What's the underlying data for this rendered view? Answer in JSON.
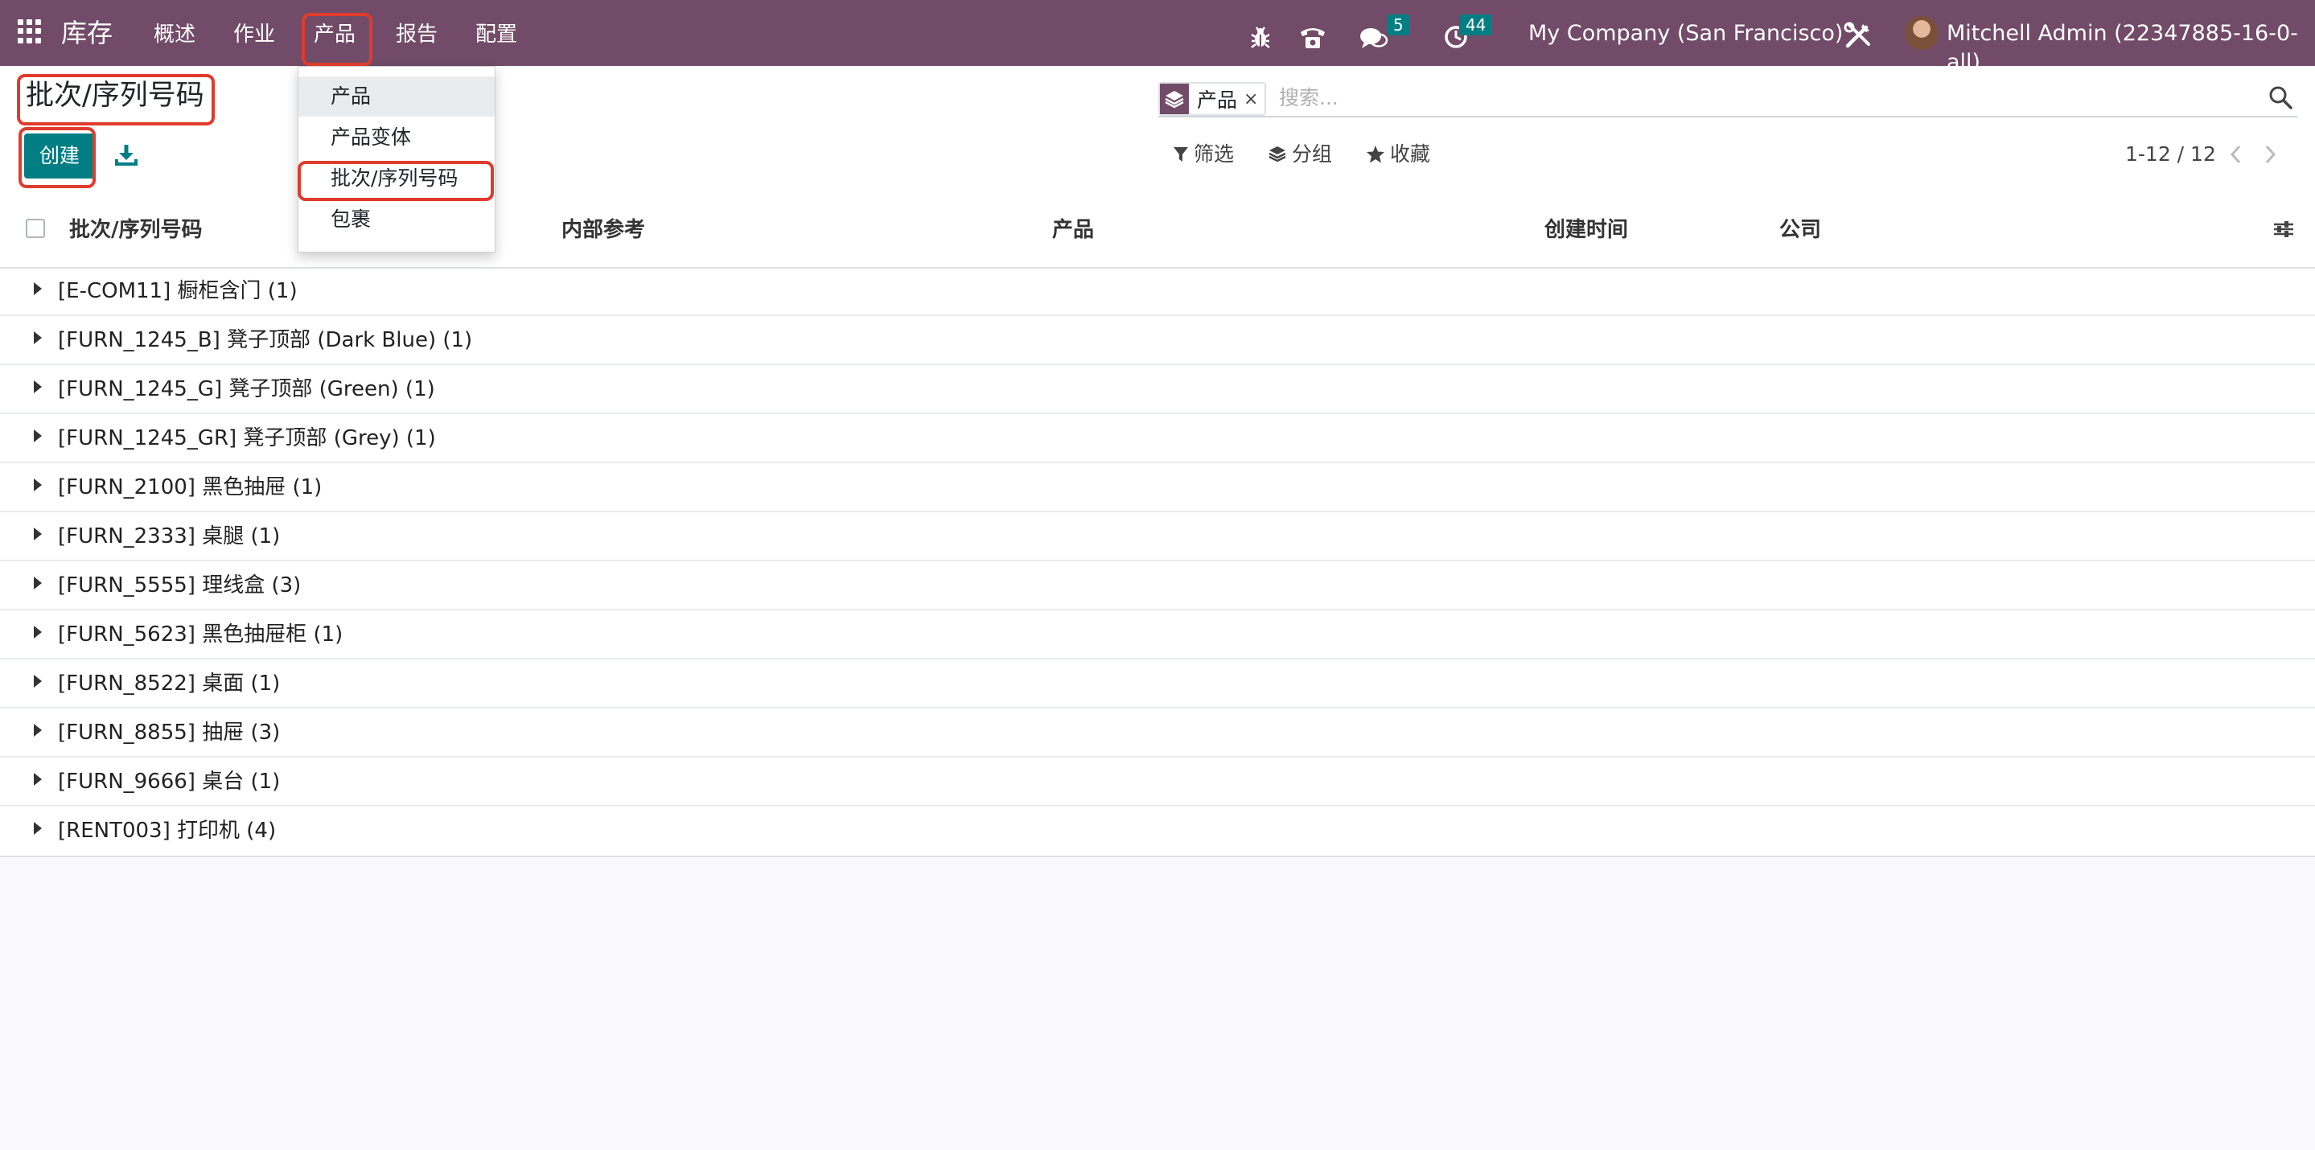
{
  "navbar": {
    "app_name": "库存",
    "menu": [
      "概述",
      "作业",
      "产品",
      "报告",
      "配置"
    ],
    "messages_count": "5",
    "activities_count": "44",
    "company": "My Company (San Francisco)",
    "user": "Mitchell Admin (22347885-16-0-all)"
  },
  "dropdown": {
    "items": [
      "产品",
      "产品变体",
      "批次/序列号码",
      "包裹"
    ]
  },
  "control": {
    "title": "批次/序列号码",
    "create_label": "创建",
    "facet_value": "产品",
    "facet_remove": "×",
    "search_placeholder": "搜索...",
    "filter_label": "筛选",
    "groupby_label": "分组",
    "favorites_label": "收藏",
    "pager": "1-12 / 12"
  },
  "list": {
    "columns": [
      "批次/序列号码",
      "内部参考",
      "产品",
      "创建时间",
      "公司"
    ],
    "rows": [
      "[E-COM11] 橱柜含门 (1)",
      "[FURN_1245_B] 凳子顶部 (Dark Blue) (1)",
      "[FURN_1245_G] 凳子顶部 (Green) (1)",
      "[FURN_1245_GR] 凳子顶部 (Grey) (1)",
      "[FURN_2100] 黑色抽屉 (1)",
      "[FURN_2333] 桌腿 (1)",
      "[FURN_5555] 理线盒 (3)",
      "[FURN_5623] 黑色抽屉柜 (1)",
      "[FURN_8522] 桌面 (1)",
      "[FURN_8855] 抽屉 (3)",
      "[FURN_9666] 桌台 (1)",
      "[RENT003] 打印机 (4)"
    ]
  },
  "colors": {
    "navbar": "#714b67",
    "primary": "#017e84",
    "highlight": "#e03b2c",
    "background": "#f9f9fb"
  }
}
